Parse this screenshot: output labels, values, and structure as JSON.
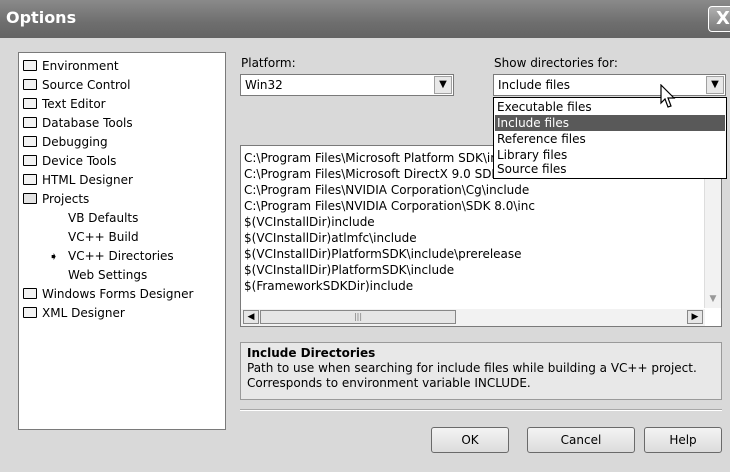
{
  "window": {
    "title": "Options",
    "close_glyph": "X"
  },
  "tree": {
    "items": [
      {
        "label": "Environment",
        "icon": "folder-icon"
      },
      {
        "label": "Source Control",
        "icon": "folder-icon"
      },
      {
        "label": "Text Editor",
        "icon": "folder-icon"
      },
      {
        "label": "Database Tools",
        "icon": "folder-icon"
      },
      {
        "label": "Debugging",
        "icon": "folder-icon"
      },
      {
        "label": "Device Tools",
        "icon": "folder-icon"
      },
      {
        "label": "HTML Designer",
        "icon": "folder-icon"
      },
      {
        "label": "Projects",
        "icon": "folder-open-icon"
      },
      {
        "label": "VB Defaults"
      },
      {
        "label": "VC++ Build"
      },
      {
        "label": "VC++ Directories",
        "selected_arrow": "➧"
      },
      {
        "label": "Web Settings"
      },
      {
        "label": "Windows Forms Designer",
        "icon": "folder-icon"
      },
      {
        "label": "XML Designer",
        "icon": "folder-icon"
      }
    ]
  },
  "platform": {
    "label": "Platform:",
    "value": "Win32"
  },
  "show_dirs": {
    "label": "Show directories for:",
    "value": "Include files",
    "options": [
      "Executable files",
      "Include files",
      "Reference files",
      "Library files",
      "Source files"
    ],
    "highlighted_index": 1
  },
  "directories": [
    "C:\\Program Files\\Microsoft Platform SDK\\in",
    "C:\\Program Files\\Microsoft DirectX 9.0 SDK",
    "C:\\Program Files\\NVIDIA Corporation\\Cg\\include",
    "C:\\Program Files\\NVIDIA Corporation\\SDK 8.0\\inc",
    "$(VCInstallDir)include",
    "$(VCInstallDir)atlmfc\\include",
    "$(VCInstallDir)PlatformSDK\\include\\prerelease",
    "$(VCInstallDir)PlatformSDK\\include",
    "$(FrameworkSDKDir)include"
  ],
  "description": {
    "title": "Include Directories",
    "line1": "Path to use when searching for include files while building a VC++ project.",
    "line2": "Corresponds to environment variable INCLUDE."
  },
  "buttons": {
    "ok": "OK",
    "cancel": "Cancel",
    "help": "Help"
  },
  "scroll_glyphs": {
    "left": "◀",
    "right": "▶",
    "down": "▼",
    "thumb": "|||",
    "combo": "▼"
  }
}
